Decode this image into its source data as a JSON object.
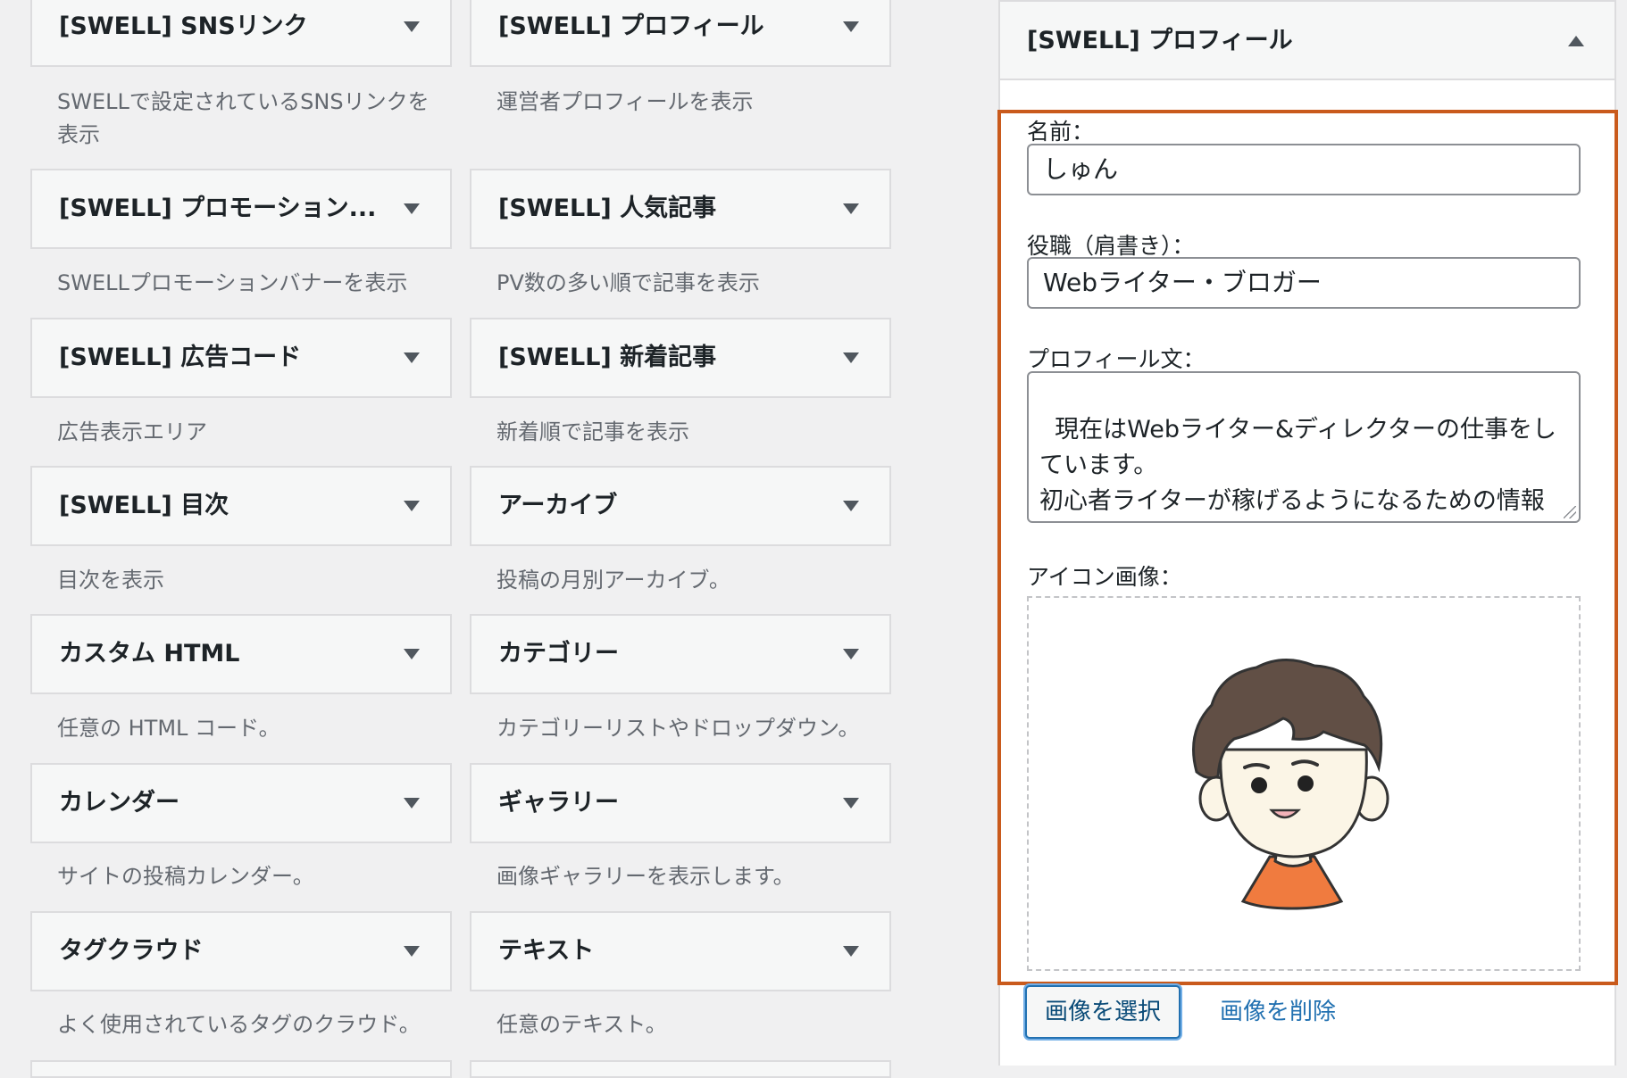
{
  "widgets": [
    {
      "title": "[SWELL] SNSリンク",
      "desc": "SWELLで設定されているSNSリンクを表示"
    },
    {
      "title": "[SWELL] プロフィール",
      "desc": "運営者プロフィールを表示"
    },
    {
      "title": "[SWELL] プロモーション...",
      "desc": "SWELLプロモーションバナーを表示"
    },
    {
      "title": "[SWELL] 人気記事",
      "desc": "PV数の多い順で記事を表示"
    },
    {
      "title": "[SWELL] 広告コード",
      "desc": "広告表示エリア"
    },
    {
      "title": "[SWELL] 新着記事",
      "desc": "新着順で記事を表示"
    },
    {
      "title": "[SWELL] 目次",
      "desc": "目次を表示"
    },
    {
      "title": "アーカイブ",
      "desc": "投稿の月別アーカイブ。"
    },
    {
      "title": "カスタム HTML",
      "desc": "任意の HTML コード。"
    },
    {
      "title": "カテゴリー",
      "desc": "カテゴリーリストやドロップダウン。"
    },
    {
      "title": "カレンダー",
      "desc": "サイトの投稿カレンダー。"
    },
    {
      "title": "ギャラリー",
      "desc": "画像ギャラリーを表示します。"
    },
    {
      "title": "タグクラウド",
      "desc": "よく使用されているタグのクラウド。"
    },
    {
      "title": "テキスト",
      "desc": "任意のテキスト。"
    }
  ],
  "panel": {
    "title": "[SWELL] プロフィール",
    "name_label": "名前：",
    "name_value": "しゅん",
    "role_label": "役職（肩書き）：",
    "role_value": "Webライター・ブロガー",
    "profile_label": "プロフィール文：",
    "profile_value": "現在はWebライター&ディレクターの仕事をしています。\n初心者ライターが稼げるようになるための情報を発信中！",
    "icon_label": "アイコン画像：",
    "select_button": "画像を選択",
    "remove_link": "画像を削除"
  }
}
